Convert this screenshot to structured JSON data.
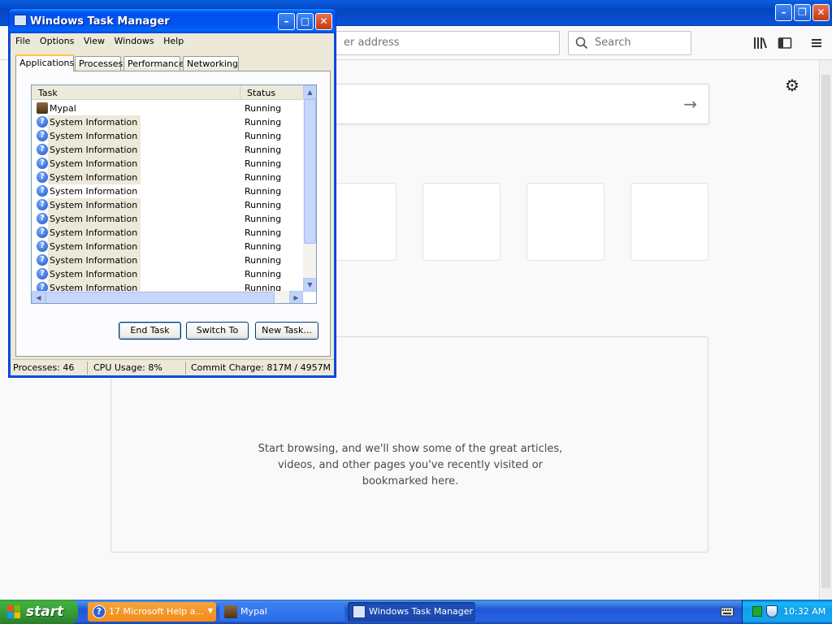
{
  "browser": {
    "url_placeholder": "er address",
    "search_placeholder": "Search",
    "highlights_line1": "Start browsing, and we'll show some of the great articles,",
    "highlights_line2": "videos, and other pages you've recently visited or",
    "highlights_line3": "bookmarked here."
  },
  "task_manager": {
    "title": "Windows Task Manager",
    "menu": [
      "File",
      "Options",
      "View",
      "Windows",
      "Help"
    ],
    "tabs": [
      "Applications",
      "Processes",
      "Performance",
      "Networking"
    ],
    "active_tab": "Applications",
    "columns": {
      "task": "Task",
      "status": "Status"
    },
    "rows": [
      {
        "task": "Mypal",
        "status": "Running"
      },
      {
        "task": "System Information",
        "status": "Running"
      },
      {
        "task": "System Information",
        "status": "Running"
      },
      {
        "task": "System Information",
        "status": "Running"
      },
      {
        "task": "System Information",
        "status": "Running"
      },
      {
        "task": "System Information",
        "status": "Running"
      },
      {
        "task": "System Information",
        "status": "Running"
      },
      {
        "task": "System Information",
        "status": "Running"
      },
      {
        "task": "System Information",
        "status": "Running"
      },
      {
        "task": "System Information",
        "status": "Running"
      },
      {
        "task": "System Information",
        "status": "Running"
      },
      {
        "task": "System Information",
        "status": "Running"
      },
      {
        "task": "System Information",
        "status": "Running"
      },
      {
        "task": "System Information",
        "status": "Running"
      }
    ],
    "buttons": {
      "end_task": "End Task",
      "switch_to": "Switch To",
      "new_task": "New Task..."
    },
    "status_bar": {
      "processes": "Processes: 46",
      "cpu": "CPU Usage: 8%",
      "commit": "Commit Charge: 817M / 4957M"
    }
  },
  "taskbar": {
    "start_label": "start",
    "items": [
      {
        "label": "17 Microsoft Help a..."
      },
      {
        "label": "Mypal"
      },
      {
        "label": "Windows Task Manager"
      }
    ],
    "clock": "10:32 AM"
  },
  "colors": {
    "xp_blue": "#0053ee",
    "start_green": "#3fb23f",
    "help_group_orange": "#f28b19"
  }
}
